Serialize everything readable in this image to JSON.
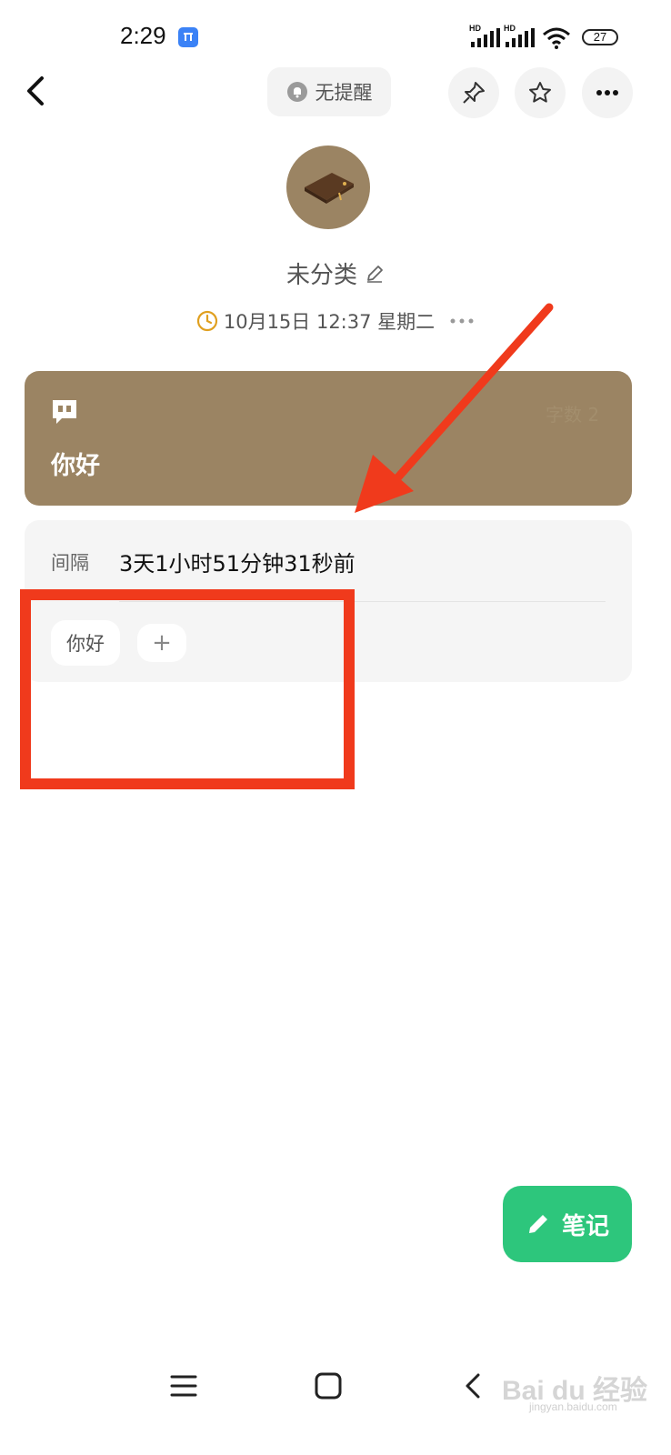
{
  "status_bar": {
    "time": "2:29",
    "battery": "27",
    "signal_1_label": "HD",
    "signal_2_label": "HD"
  },
  "top_bar": {
    "reminder_label": "无提醒"
  },
  "note": {
    "category": "未分类",
    "date": "10月15日 12:37 星期二",
    "text": "你好",
    "word_count": "字数 2"
  },
  "info": {
    "interval_label": "间隔",
    "interval_value": "3天1小时51分钟31秒前",
    "tags": [
      "你好"
    ],
    "add_tag": "+"
  },
  "fab": {
    "label": "笔记"
  },
  "watermark": {
    "main": "Bai du 经验",
    "sub": "jingyan.baidu.com"
  },
  "colors": {
    "accent": "#9b8463",
    "fab": "#2dc67c",
    "annotation": "#f03a1c"
  }
}
